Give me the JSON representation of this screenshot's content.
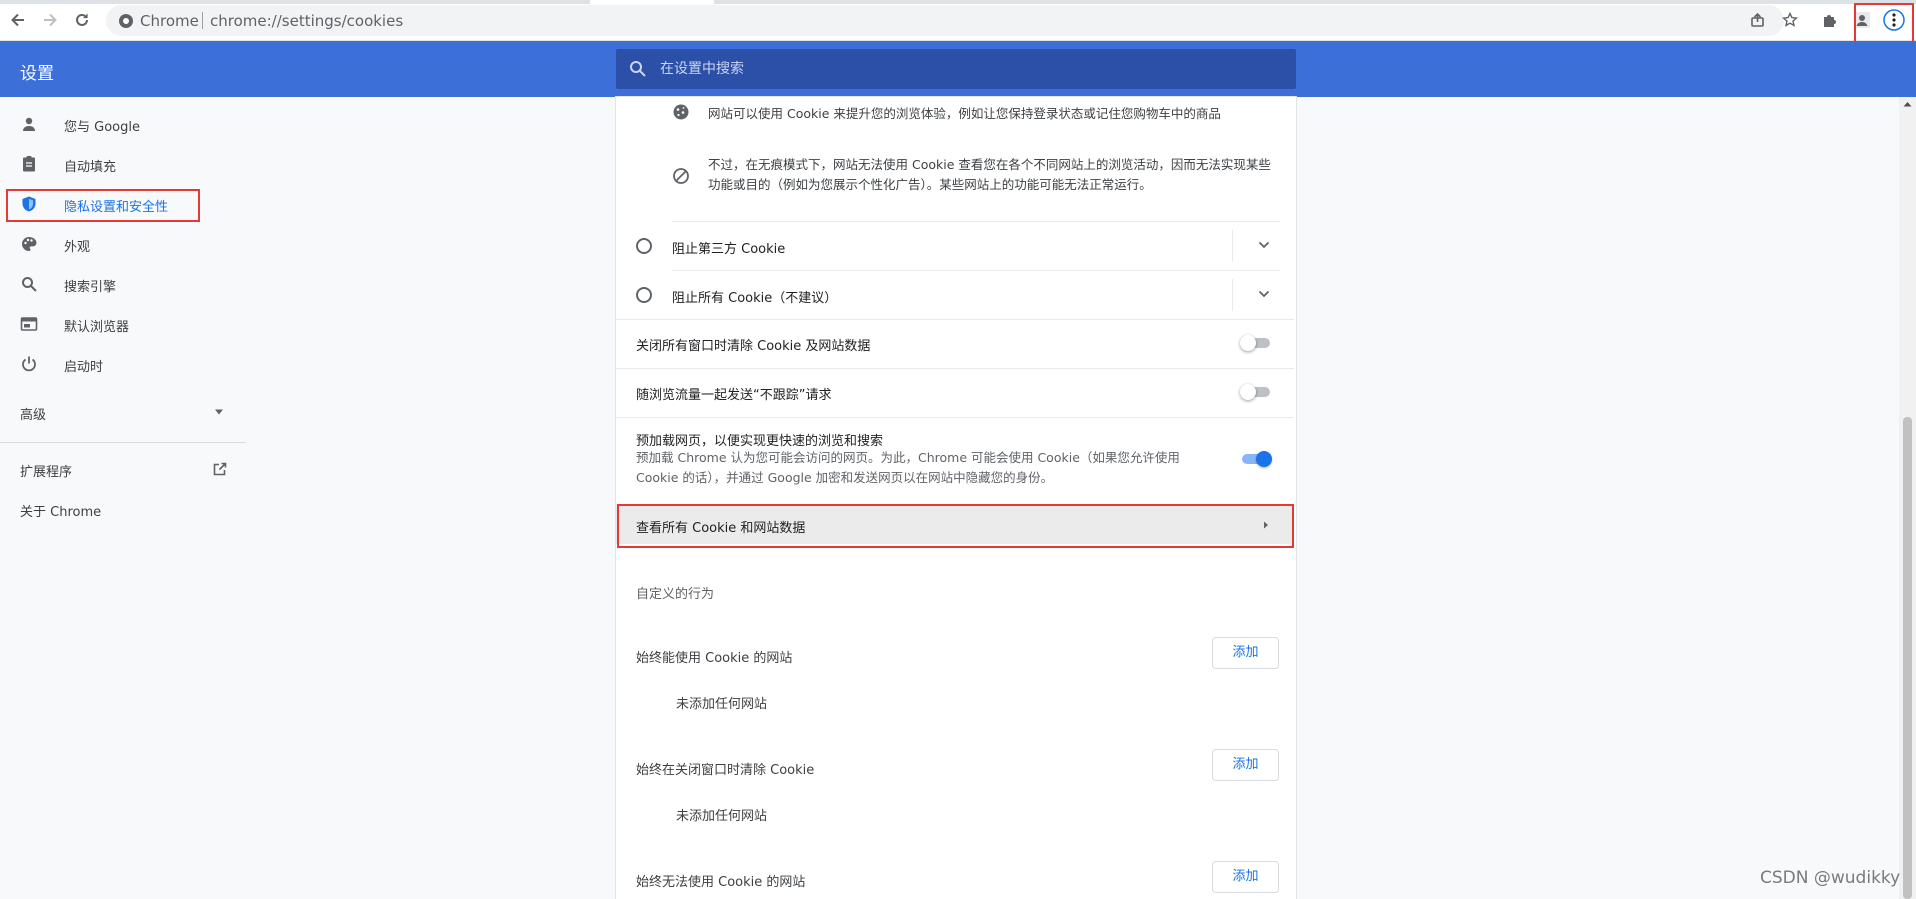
{
  "browser": {
    "omnibox_site": "Chrome",
    "url": "chrome://settings/cookies"
  },
  "header": {
    "title": "设置",
    "search_placeholder": "在设置中搜索"
  },
  "sidebar": {
    "items": [
      {
        "label": "您与 Google"
      },
      {
        "label": "自动填充"
      },
      {
        "label": "隐私设置和安全性"
      },
      {
        "label": "外观"
      },
      {
        "label": "搜索引擎"
      },
      {
        "label": "默认浏览器"
      },
      {
        "label": "启动时"
      }
    ],
    "advanced": "高级",
    "extensions": "扩展程序",
    "about": "关于 Chrome"
  },
  "main": {
    "info_cookie": "网站可以使用 Cookie 来提升您的浏览体验，例如让您保持登录状态或记住您购物车中的商品",
    "info_incognito": "不过，在无痕模式下，网站无法使用 Cookie 查看您在各个不同网站上的浏览活动，因而无法实现某些功能或目的（例如为您展示个性化广告）。某些网站上的功能可能无法正常运行。",
    "radio_block_third_party": "阻止第三方 Cookie",
    "radio_block_all": "阻止所有 Cookie（不建议）",
    "toggle_clear_on_exit": "关闭所有窗口时清除 Cookie 及网站数据",
    "toggle_do_not_track": "随浏览流量一起发送“不跟踪”请求",
    "preload_title": "预加载网页，以便实现更快速的浏览和搜索",
    "preload_desc": "预加载 Chrome 认为您可能会访问的网页。为此，Chrome 可能会使用 Cookie（如果您允许使用 Cookie 的话），并通过 Google 加密和发送网页以在网站中隐藏您的身份。",
    "see_all_cookies": "查看所有 Cookie 和网站数据",
    "custom_behaviors": "自定义的行为",
    "always_allow": "始终能使用 Cookie 的网站",
    "always_clear": "始终在关闭窗口时清除 Cookie",
    "always_block": "始终无法使用 Cookie 的网站",
    "no_sites": "未添加任何网站",
    "add_button": "添加"
  },
  "toggles": {
    "clear_on_exit": false,
    "do_not_track": false,
    "preload": true
  },
  "colors": {
    "header": "#3c6fd8",
    "accent": "#1a73e8",
    "highlight_box": "#e53935"
  },
  "watermark": "CSDN @wudikky"
}
